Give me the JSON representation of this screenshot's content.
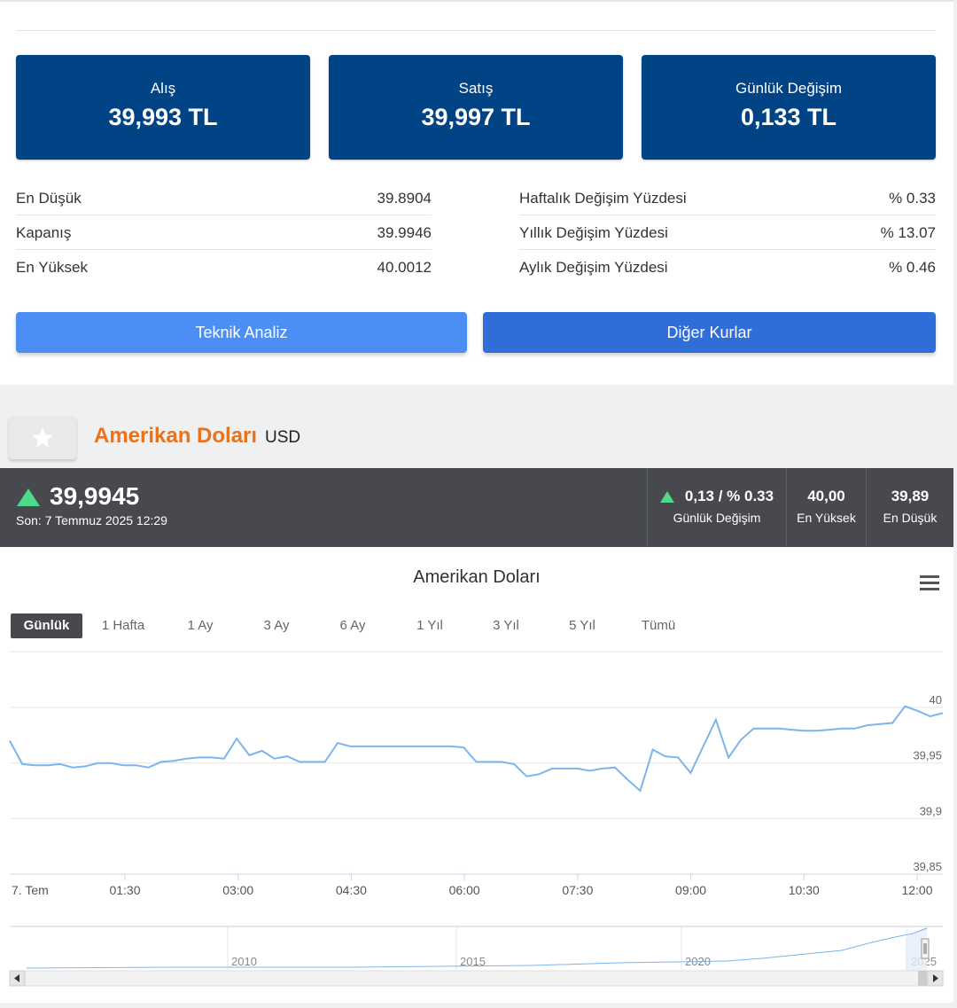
{
  "summary": {
    "alis": {
      "label": "Alış",
      "value": "39,993 TL"
    },
    "satis": {
      "label": "Satış",
      "value": "39,997 TL"
    },
    "degisim": {
      "label": "Günlük Değişim",
      "value": "0,133 TL"
    }
  },
  "details_left": [
    {
      "label": "En Düşük",
      "value": "39.8904"
    },
    {
      "label": "Kapanış",
      "value": "39.9946"
    },
    {
      "label": "En Yüksek",
      "value": "40.0012"
    }
  ],
  "details_right": [
    {
      "label": "Haftalık Değişim Yüzdesi",
      "value": "% 0.33"
    },
    {
      "label": "Yıllık Değişim Yüzdesi",
      "value": "% 13.07"
    },
    {
      "label": "Aylık Değişim Yüzdesi",
      "value": "% 0.46"
    }
  ],
  "buttons": {
    "teknik_analiz": "Teknik Analiz",
    "diger_kurlar": "Diğer Kurlar"
  },
  "currency": {
    "name": "Amerikan Doları",
    "code": "USD"
  },
  "ticker": {
    "price": "39,9945",
    "last_update": "Son: 7 Temmuz 2025 12:29",
    "change_value": "0,13 / % 0.33",
    "change_label": "Günlük Değişim",
    "high_value": "40,00",
    "high_label": "En Yüksek",
    "low_value": "39,89",
    "low_label": "En Düşük",
    "up_color": "#4fd98a"
  },
  "chart": {
    "title": "Amerikan Doları",
    "ranges": [
      "Günlük",
      "1 Hafta",
      "1 Ay",
      "3 Ay",
      "6 Ay",
      "1 Yıl",
      "3 Yıl",
      "5 Yıl",
      "Tümü"
    ],
    "active_range": "Günlük",
    "line_color": "#7cb5ec"
  },
  "chart_data": {
    "type": "line",
    "title": "Amerikan Doları",
    "xlabel": "",
    "ylabel": "",
    "x_ticks": [
      "7. Tem",
      "01:30",
      "03:00",
      "04:30",
      "06:00",
      "07:30",
      "09:00",
      "10:30",
      "12:00"
    ],
    "y_ticks": [
      "40",
      "39,95",
      "39,9",
      "39,85"
    ],
    "ylim": [
      39.85,
      40.0
    ],
    "grid": true,
    "series": [
      {
        "values": [
          39.97,
          39.949,
          39.948,
          39.948,
          39.949,
          39.946,
          39.947,
          39.95,
          39.95,
          39.948,
          39.948,
          39.946,
          39.951,
          39.952,
          39.954,
          39.955,
          39.955,
          39.954,
          39.972,
          39.957,
          39.961,
          39.954,
          39.956,
          39.951,
          39.951,
          39.951,
          39.968,
          39.965,
          39.965,
          39.965,
          39.965,
          39.965,
          39.965,
          39.965,
          39.965,
          39.965,
          39.964,
          39.951,
          39.951,
          39.951,
          39.949,
          39.938,
          39.94,
          39.945,
          39.945,
          39.945,
          39.943,
          39.945,
          39.946,
          39.935,
          39.925,
          39.962,
          39.956,
          39.955,
          39.941,
          39.965,
          39.989,
          39.955,
          39.971,
          39.981,
          39.981,
          39.981,
          39.98,
          39.979,
          39.979,
          39.98,
          39.981,
          39.981,
          39.984,
          39.985,
          39.986,
          40.001,
          39.997,
          39.992,
          39.995
        ]
      }
    ],
    "navigator_ticks": [
      "2010",
      "2015",
      "2020",
      "2025"
    ]
  }
}
